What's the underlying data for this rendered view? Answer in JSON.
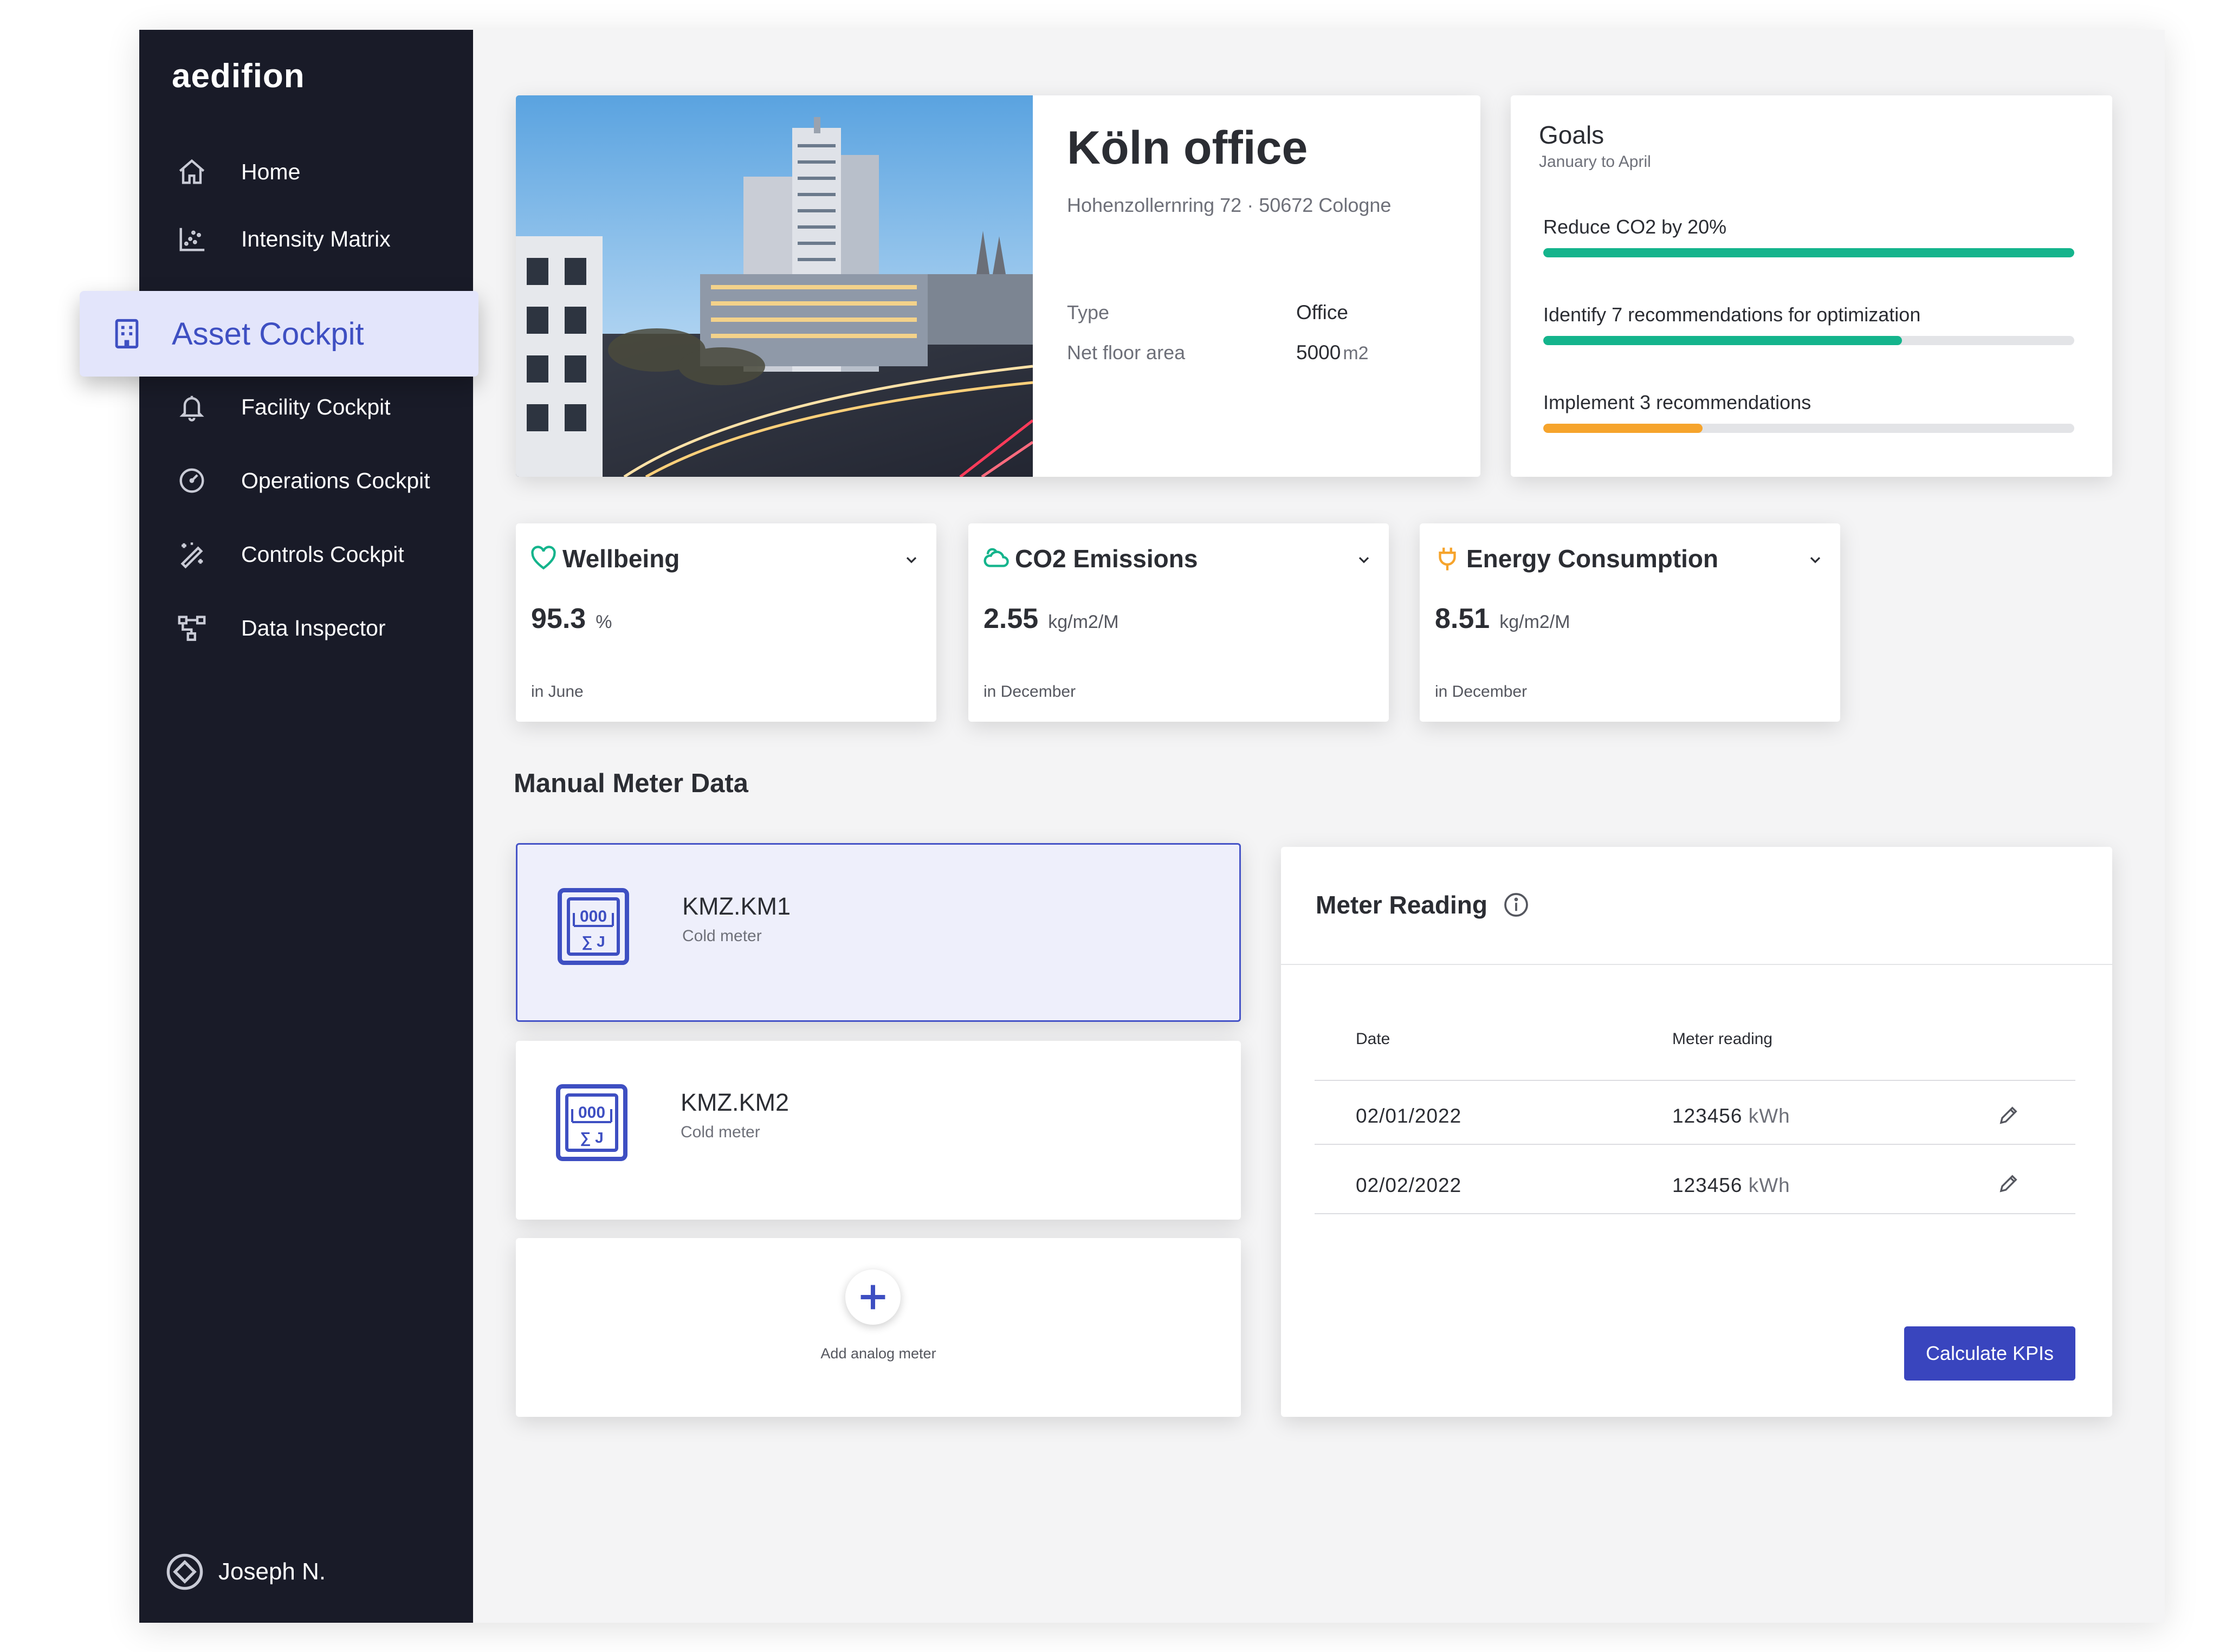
{
  "app": {
    "logo": "aedifion"
  },
  "sidebar": {
    "items": [
      {
        "label": "Home",
        "icon": "home-icon"
      },
      {
        "label": "Intensity Matrix",
        "icon": "scatter-chart-icon"
      },
      {
        "label": "Asset Cockpit",
        "icon": "building-icon",
        "active": true
      },
      {
        "label": "Facility Cockpit",
        "icon": "bell-icon"
      },
      {
        "label": "Operations Cockpit",
        "icon": "gauge-icon"
      },
      {
        "label": "Controls Cockpit",
        "icon": "magic-wand-icon"
      },
      {
        "label": "Data Inspector",
        "icon": "network-icon"
      }
    ],
    "user": {
      "name": "Joseph N.",
      "icon": "diamond-icon"
    },
    "colors": {
      "background": "#191b28",
      "active_bg": "#e3e5fb",
      "active_text": "#3e4fc2"
    }
  },
  "building": {
    "title": "Köln office",
    "address": "Hohenzollernring 72 · 50672 Cologne",
    "type_label": "Type",
    "type_value": "Office",
    "area_label": "Net floor area",
    "area_value": "5000",
    "area_unit": "m2"
  },
  "goals": {
    "title": "Goals",
    "subtitle": "January to April",
    "items": [
      {
        "label": "Reduce CO2 by 20%",
        "progress": 1.0,
        "color": "#14b48c"
      },
      {
        "label": "Identify 7 recommendations for optimization",
        "progress": 0.675,
        "color": "#14b48c"
      },
      {
        "label": "Implement 3 recommendations",
        "progress": 0.3,
        "color": "#f6a42c"
      }
    ]
  },
  "kpis": [
    {
      "title": "Wellbeing",
      "value": "95.3",
      "unit": "%",
      "period": "in June",
      "icon": "heart-icon",
      "color": "#14b48c"
    },
    {
      "title": "CO2 Emissions",
      "value": "2.55",
      "unit": "kg/m2/M",
      "period": "in December",
      "icon": "cloud-icon",
      "color": "#14b48c"
    },
    {
      "title": "Energy Consumption",
      "value": "8.51",
      "unit": "kg/m2/M",
      "period": "in December",
      "icon": "plug-icon",
      "color": "#f6a42c"
    }
  ],
  "meters_section": {
    "title": "Manual Meter Data",
    "meters": [
      {
        "name": "KMZ.KM1",
        "type": "Cold meter",
        "selected": true
      },
      {
        "name": "KMZ.KM2",
        "type": "Cold meter",
        "selected": false
      }
    ],
    "add_label": "Add analog meter"
  },
  "reading": {
    "title": "Meter Reading",
    "columns": [
      "Date",
      "Meter reading"
    ],
    "rows": [
      {
        "date": "02/01/2022",
        "value": "123456",
        "unit": "kWh"
      },
      {
        "date": "02/02/2022",
        "value": "123456",
        "unit": "kWh"
      }
    ],
    "button_label": "Calculate KPIs",
    "meter_glyph": {
      "digits": "000",
      "symbol": "∑ J"
    }
  }
}
